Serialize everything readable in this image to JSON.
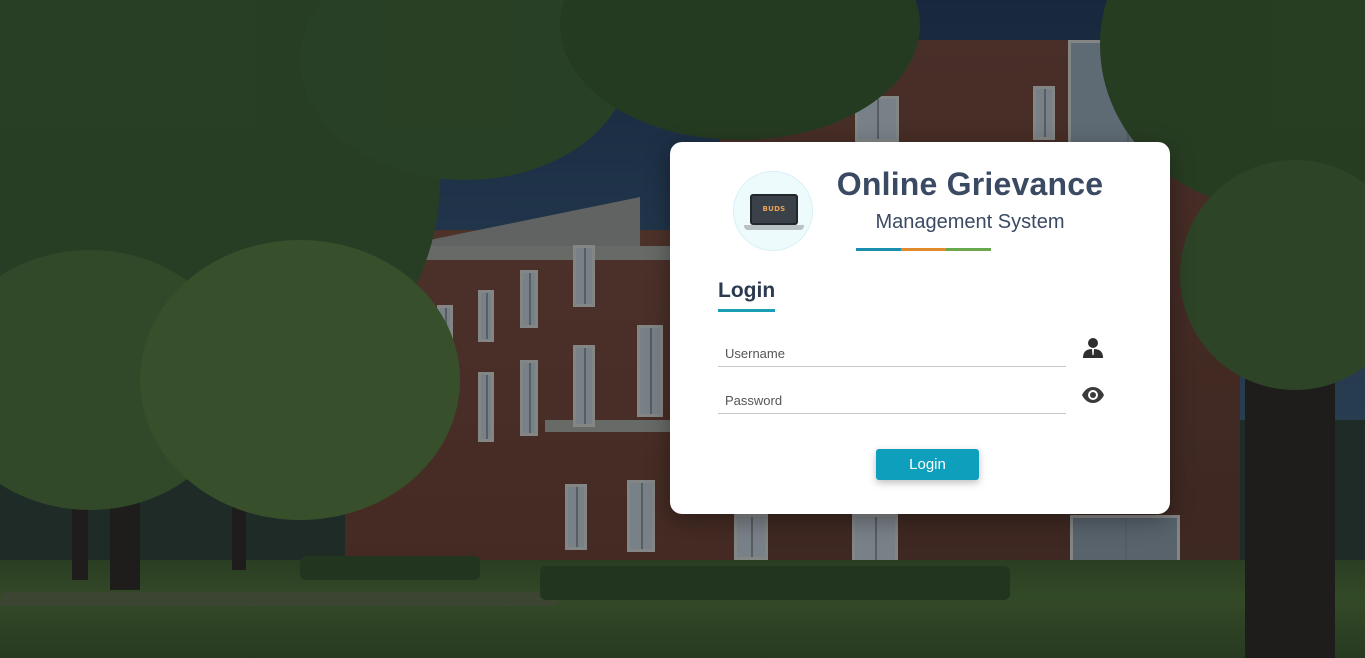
{
  "app": {
    "title": "Online Grievance",
    "subtitle": "Management System",
    "logo_text": "BUDS",
    "accent_colors": [
      "#1a8fb0",
      "#e08a2c",
      "#6aa84f"
    ]
  },
  "login": {
    "heading": "Login",
    "username_placeholder": "Username",
    "password_placeholder": "Password",
    "username_icon": "user-icon",
    "password_icon": "eye-icon",
    "submit_label": "Login",
    "button_color": "#0e9fbc"
  }
}
